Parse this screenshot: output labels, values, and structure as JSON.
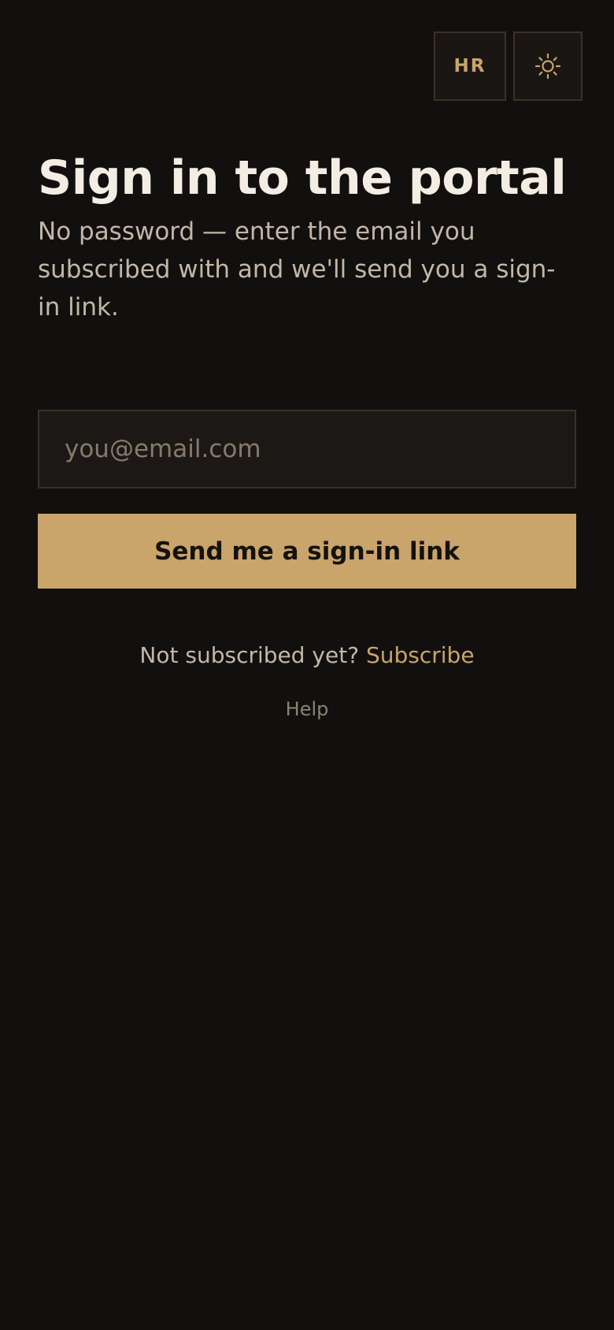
{
  "header": {
    "language_label": "HR",
    "theme_icon": "sun-icon"
  },
  "main": {
    "title": "Sign in to the portal",
    "subtitle": "No password — enter the email you subscribed with and we'll send you a sign-in link.",
    "email_value": "",
    "email_placeholder": "you@email.com",
    "submit_label": "Send me a sign-in link",
    "subscribe_prompt": "Not subscribed yet?",
    "subscribe_link": "Subscribe",
    "help_link": "Help"
  },
  "colors": {
    "background": "#12100e",
    "accent": "#c9a46b",
    "text_primary": "#f3ede3",
    "text_secondary": "#c2b7a8",
    "border": "#3a3128"
  }
}
